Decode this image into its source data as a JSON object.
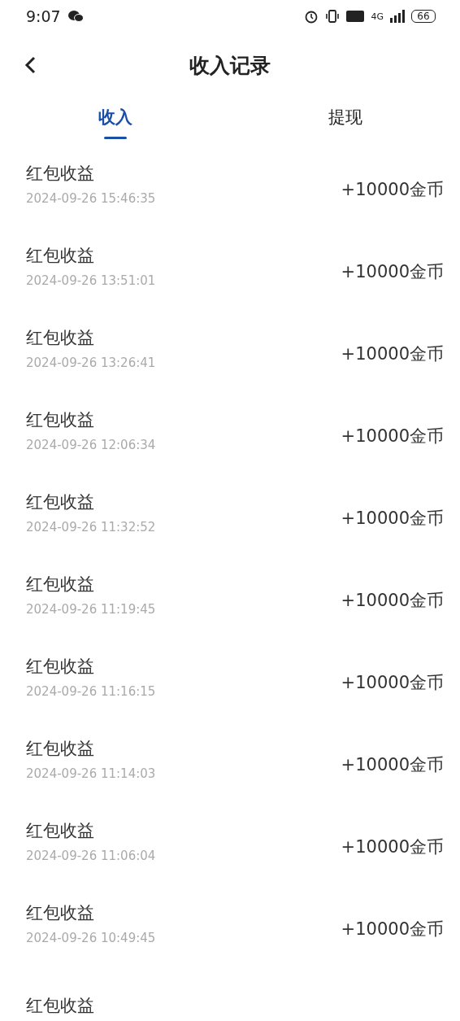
{
  "status_bar": {
    "time": "9:07",
    "network": "4G",
    "battery": "66"
  },
  "header": {
    "title": "收入记录"
  },
  "tabs": [
    {
      "label": "收入",
      "selected": true
    },
    {
      "label": "提现",
      "selected": false
    }
  ],
  "records": [
    {
      "title": "红包收益",
      "time": "2024-09-26 15:46:35",
      "amount": "+10000金币"
    },
    {
      "title": "红包收益",
      "time": "2024-09-26 13:51:01",
      "amount": "+10000金币"
    },
    {
      "title": "红包收益",
      "time": "2024-09-26 13:26:41",
      "amount": "+10000金币"
    },
    {
      "title": "红包收益",
      "time": "2024-09-26 12:06:34",
      "amount": "+10000金币"
    },
    {
      "title": "红包收益",
      "time": "2024-09-26 11:32:52",
      "amount": "+10000金币"
    },
    {
      "title": "红包收益",
      "time": "2024-09-26 11:19:45",
      "amount": "+10000金币"
    },
    {
      "title": "红包收益",
      "time": "2024-09-26 11:16:15",
      "amount": "+10000金币"
    },
    {
      "title": "红包收益",
      "time": "2024-09-26 11:14:03",
      "amount": "+10000金币"
    },
    {
      "title": "红包收益",
      "time": "2024-09-26 11:06:04",
      "amount": "+10000金币"
    },
    {
      "title": "红包收益",
      "time": "2024-09-26 10:49:45",
      "amount": "+10000金币"
    },
    {
      "title": "红包收益"
    }
  ]
}
